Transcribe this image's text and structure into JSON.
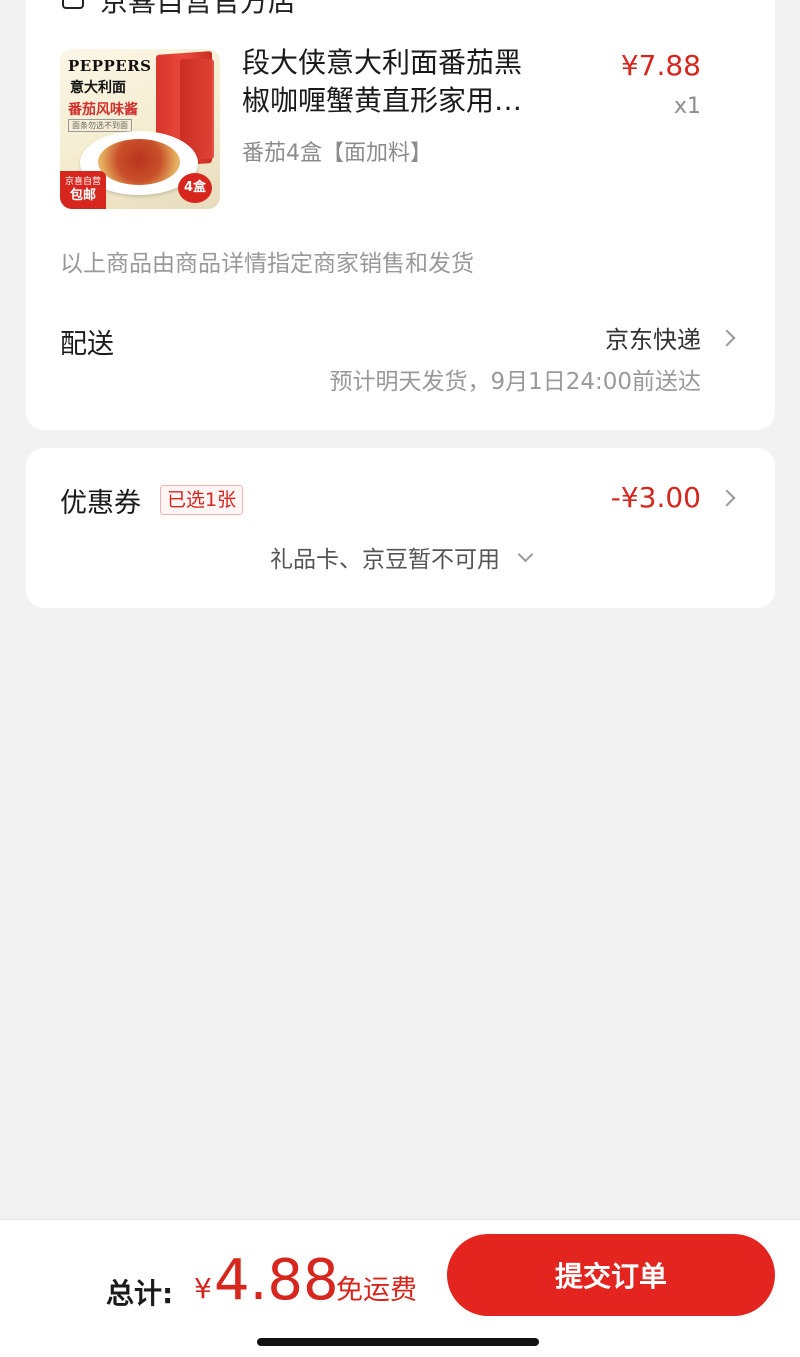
{
  "shop": {
    "name": "京喜自营官方店",
    "icon": "store-icon"
  },
  "product": {
    "image": {
      "brand": "PEPPERS",
      "name_cn": "意大利面",
      "flavor": "番茄风味酱",
      "sub": "面条勿选不到面",
      "ribbon_top": "京喜自营",
      "ribbon_bottom": "包邮",
      "count_badge": "4盒"
    },
    "title_line1": "段大侠意大利面番茄黑",
    "title_line2": "椒咖喱蟹黄直形家用…",
    "spec": "番茄4盒【面加料】",
    "price": "¥7.88",
    "quantity": "x1"
  },
  "seller_note": "以上商品由商品详情指定商家销售和发货",
  "delivery": {
    "label": "配送",
    "method": "京东快递",
    "eta": "预计明天发货，9月1日24:00前送达"
  },
  "coupon": {
    "label": "优惠券",
    "badge": "已选1张",
    "amount": "-¥3.00",
    "gift_card_note": "礼品卡、京豆暂不可用"
  },
  "bottom_bar": {
    "total_label": "总计:",
    "currency": "¥",
    "total_amount": "4.88",
    "shipping_note": "免运费",
    "submit_label": "提交订单"
  },
  "colors": {
    "accent_red": "#e4251f",
    "price_red": "#d6261e",
    "background": "#f2f2f2"
  }
}
